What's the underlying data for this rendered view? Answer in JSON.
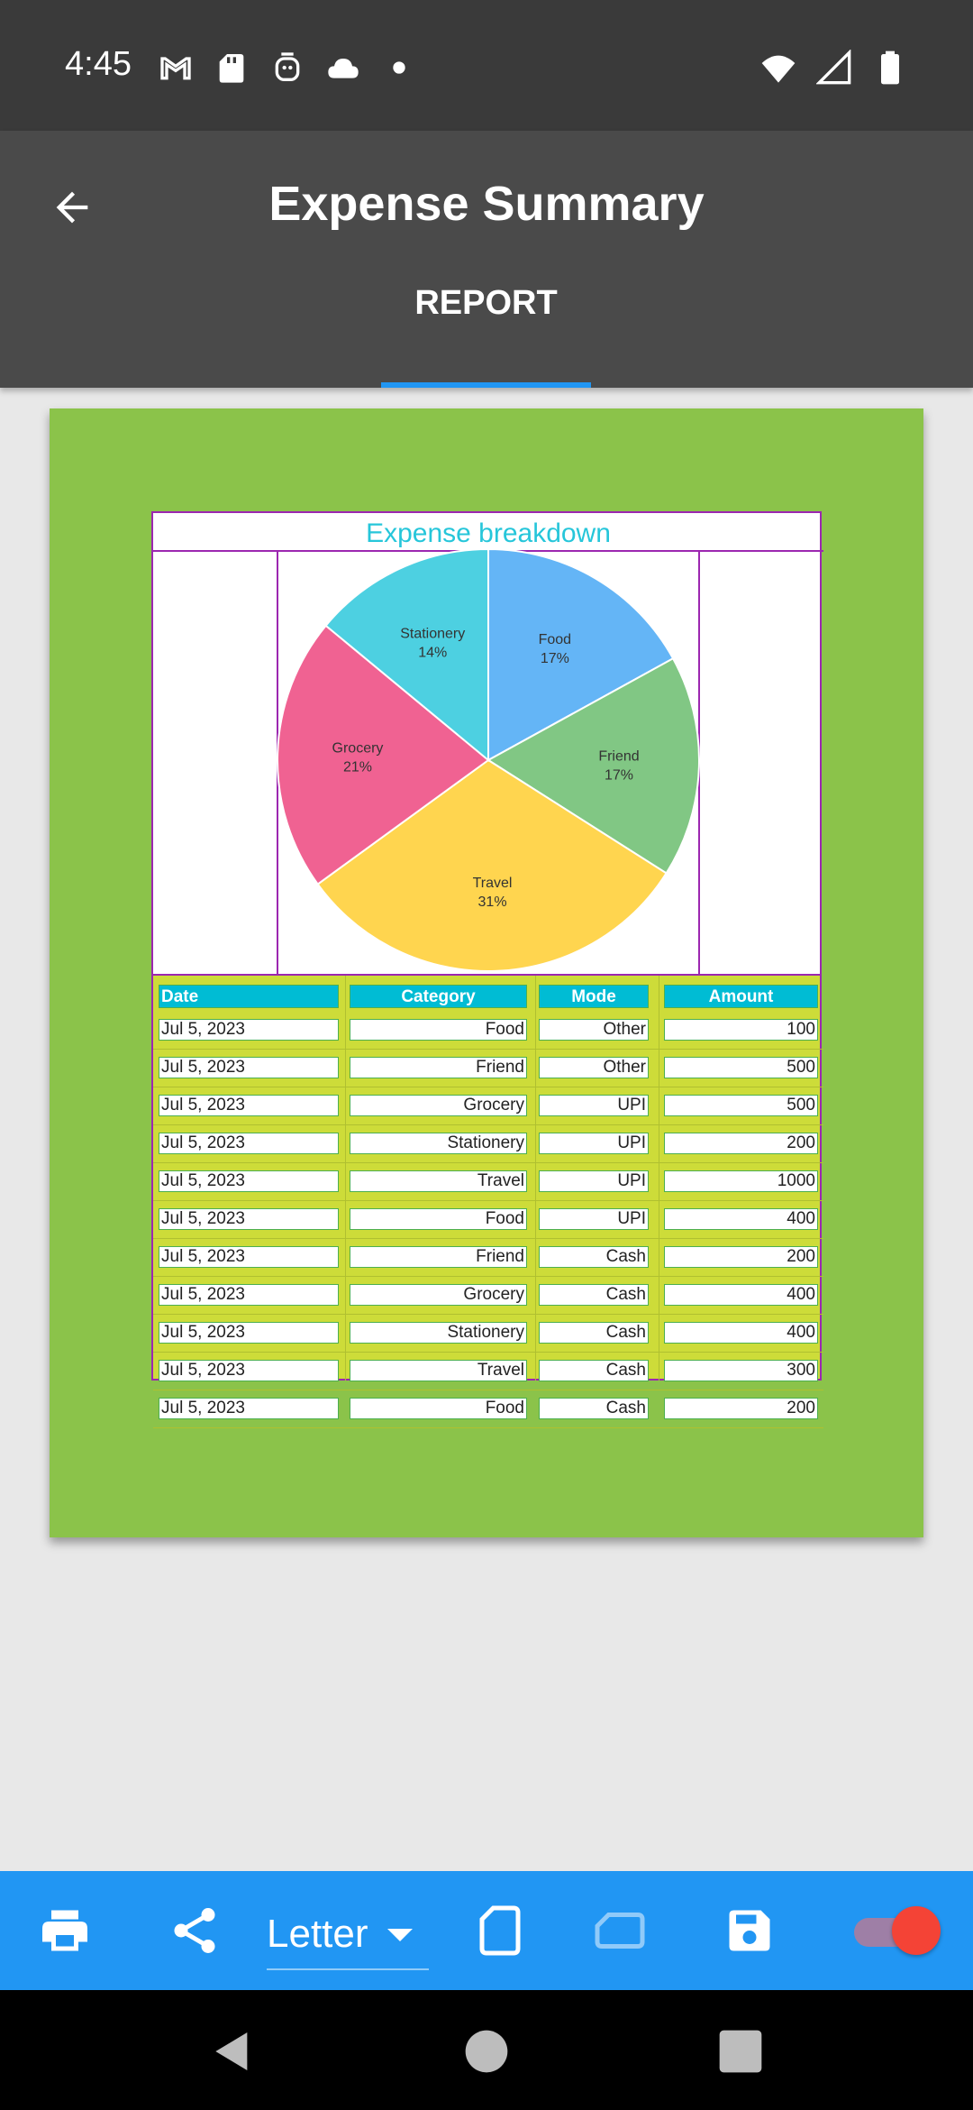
{
  "status": {
    "time": "4:45",
    "left_icons": [
      "gmail-icon",
      "sd-card-icon",
      "face-icon",
      "cloud-icon",
      "dot-icon"
    ],
    "right_icons": [
      "wifi-icon",
      "signal-icon",
      "battery-icon"
    ]
  },
  "app_bar": {
    "title": "Expense Summary",
    "back_icon": "arrow-back-icon",
    "tabs": [
      {
        "label": "REPORT",
        "active": true
      }
    ]
  },
  "report": {
    "page_color": "#8bc34a",
    "chart_data": {
      "type": "pie",
      "title": "Expense breakdown",
      "categories": [
        "Food",
        "Friend",
        "Travel",
        "Grocery",
        "Stationery"
      ],
      "values": [
        17,
        17,
        31,
        21,
        14
      ],
      "labels": [
        "17%",
        "17%",
        "31%",
        "21%",
        "14%"
      ],
      "colors": [
        "#64b5f6",
        "#81c784",
        "#ffd54f",
        "#f06292",
        "#4dd0e1"
      ]
    },
    "table": {
      "headers": [
        "Date",
        "Category",
        "Mode",
        "Amount"
      ],
      "header_color": "#00bcd4",
      "rows": [
        [
          "Jul 5, 2023",
          "Food",
          "Other",
          "100"
        ],
        [
          "Jul 5, 2023",
          "Friend",
          "Other",
          "500"
        ],
        [
          "Jul 5, 2023",
          "Grocery",
          "UPI",
          "500"
        ],
        [
          "Jul 5, 2023",
          "Stationery",
          "UPI",
          "200"
        ],
        [
          "Jul 5, 2023",
          "Travel",
          "UPI",
          "1000"
        ],
        [
          "Jul 5, 2023",
          "Food",
          "UPI",
          "400"
        ],
        [
          "Jul 5, 2023",
          "Friend",
          "Cash",
          "200"
        ],
        [
          "Jul 5, 2023",
          "Grocery",
          "Cash",
          "400"
        ],
        [
          "Jul 5, 2023",
          "Stationery",
          "Cash",
          "400"
        ],
        [
          "Jul 5, 2023",
          "Travel",
          "Cash",
          "300"
        ],
        [
          "Jul 5, 2023",
          "Food",
          "Cash",
          "200"
        ]
      ]
    }
  },
  "toolbar": {
    "paper_size": "Letter",
    "icons": [
      "print-icon",
      "share-icon",
      "portrait-icon",
      "landscape-icon",
      "save-icon"
    ],
    "toggle_on": true,
    "bar_color": "#2196f3"
  }
}
